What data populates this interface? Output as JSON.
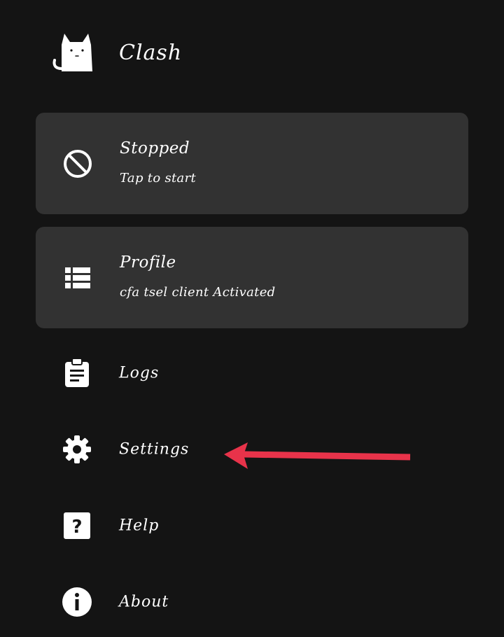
{
  "app": {
    "title": "Clash",
    "logo_icon": "cat-icon"
  },
  "status_card": {
    "icon": "stopped-icon",
    "title": "Stopped",
    "subtitle": "Tap to start"
  },
  "profile_card": {
    "icon": "list-icon",
    "title": "Profile",
    "subtitle": "cfa tsel client Activated"
  },
  "menu": {
    "items": [
      {
        "icon": "clipboard-icon",
        "label": "Logs"
      },
      {
        "icon": "gear-icon",
        "label": "Settings"
      },
      {
        "icon": "help-icon",
        "label": "Help"
      },
      {
        "icon": "info-icon",
        "label": "About"
      }
    ]
  },
  "annotation": {
    "arrow_color": "#e8334a"
  },
  "colors": {
    "background": "#141414",
    "card": "#323232",
    "text": "#ffffff"
  }
}
